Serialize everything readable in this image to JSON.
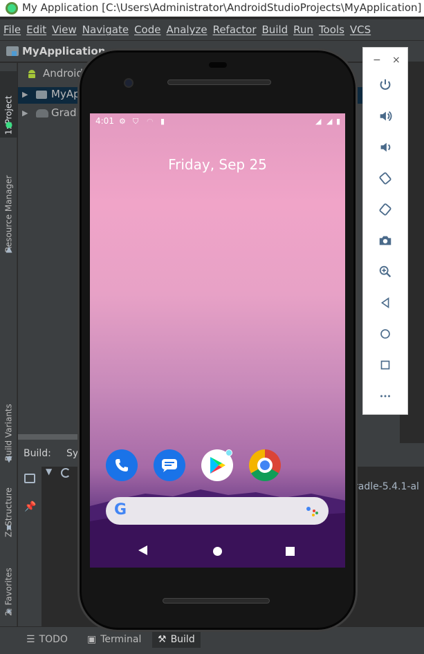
{
  "window": {
    "title": "My Application [C:\\Users\\Administrator\\AndroidStudioProjects\\MyApplication]"
  },
  "menu": [
    "File",
    "Edit",
    "View",
    "Navigate",
    "Code",
    "Analyze",
    "Refactor",
    "Build",
    "Run",
    "Tools",
    "VCS"
  ],
  "breadcrumb": "MyApplication",
  "left_tool_tabs": {
    "project": "1: Project",
    "resource_manager": "Resource Manager",
    "build_variants": "Build Variants",
    "structure": "Z: Structure",
    "favorites": "2: Favorites"
  },
  "project_tree": {
    "view_mode": "Android",
    "items": [
      {
        "label": "MyAp"
      },
      {
        "label": "Gradl"
      }
    ]
  },
  "build_window": {
    "label": "Build:",
    "sync_tab": "Sy",
    "output_text": "radle-5.4.1-al"
  },
  "bottom_tabs": {
    "todo": "TODO",
    "terminal": "Terminal",
    "build": "Build"
  },
  "emulator": {
    "status_time": "4:01",
    "date": "Friday, Sep 25",
    "dock_apps": [
      "phone-app",
      "messages-app",
      "play-store-app",
      "chrome-app"
    ],
    "toolbar_buttons": [
      "power",
      "volume-up",
      "volume-down",
      "rotate-left",
      "rotate-right",
      "screenshot",
      "zoom",
      "back",
      "home",
      "overview",
      "more"
    ],
    "window_controls": {
      "minimize": "−",
      "close": "×"
    }
  },
  "colors": {
    "ide_background": "#2b2b2b",
    "ide_panel": "#3c3f41",
    "selection": "#0d293e",
    "android_green": "#3ddc84",
    "google_blue": "#1a73e8"
  }
}
